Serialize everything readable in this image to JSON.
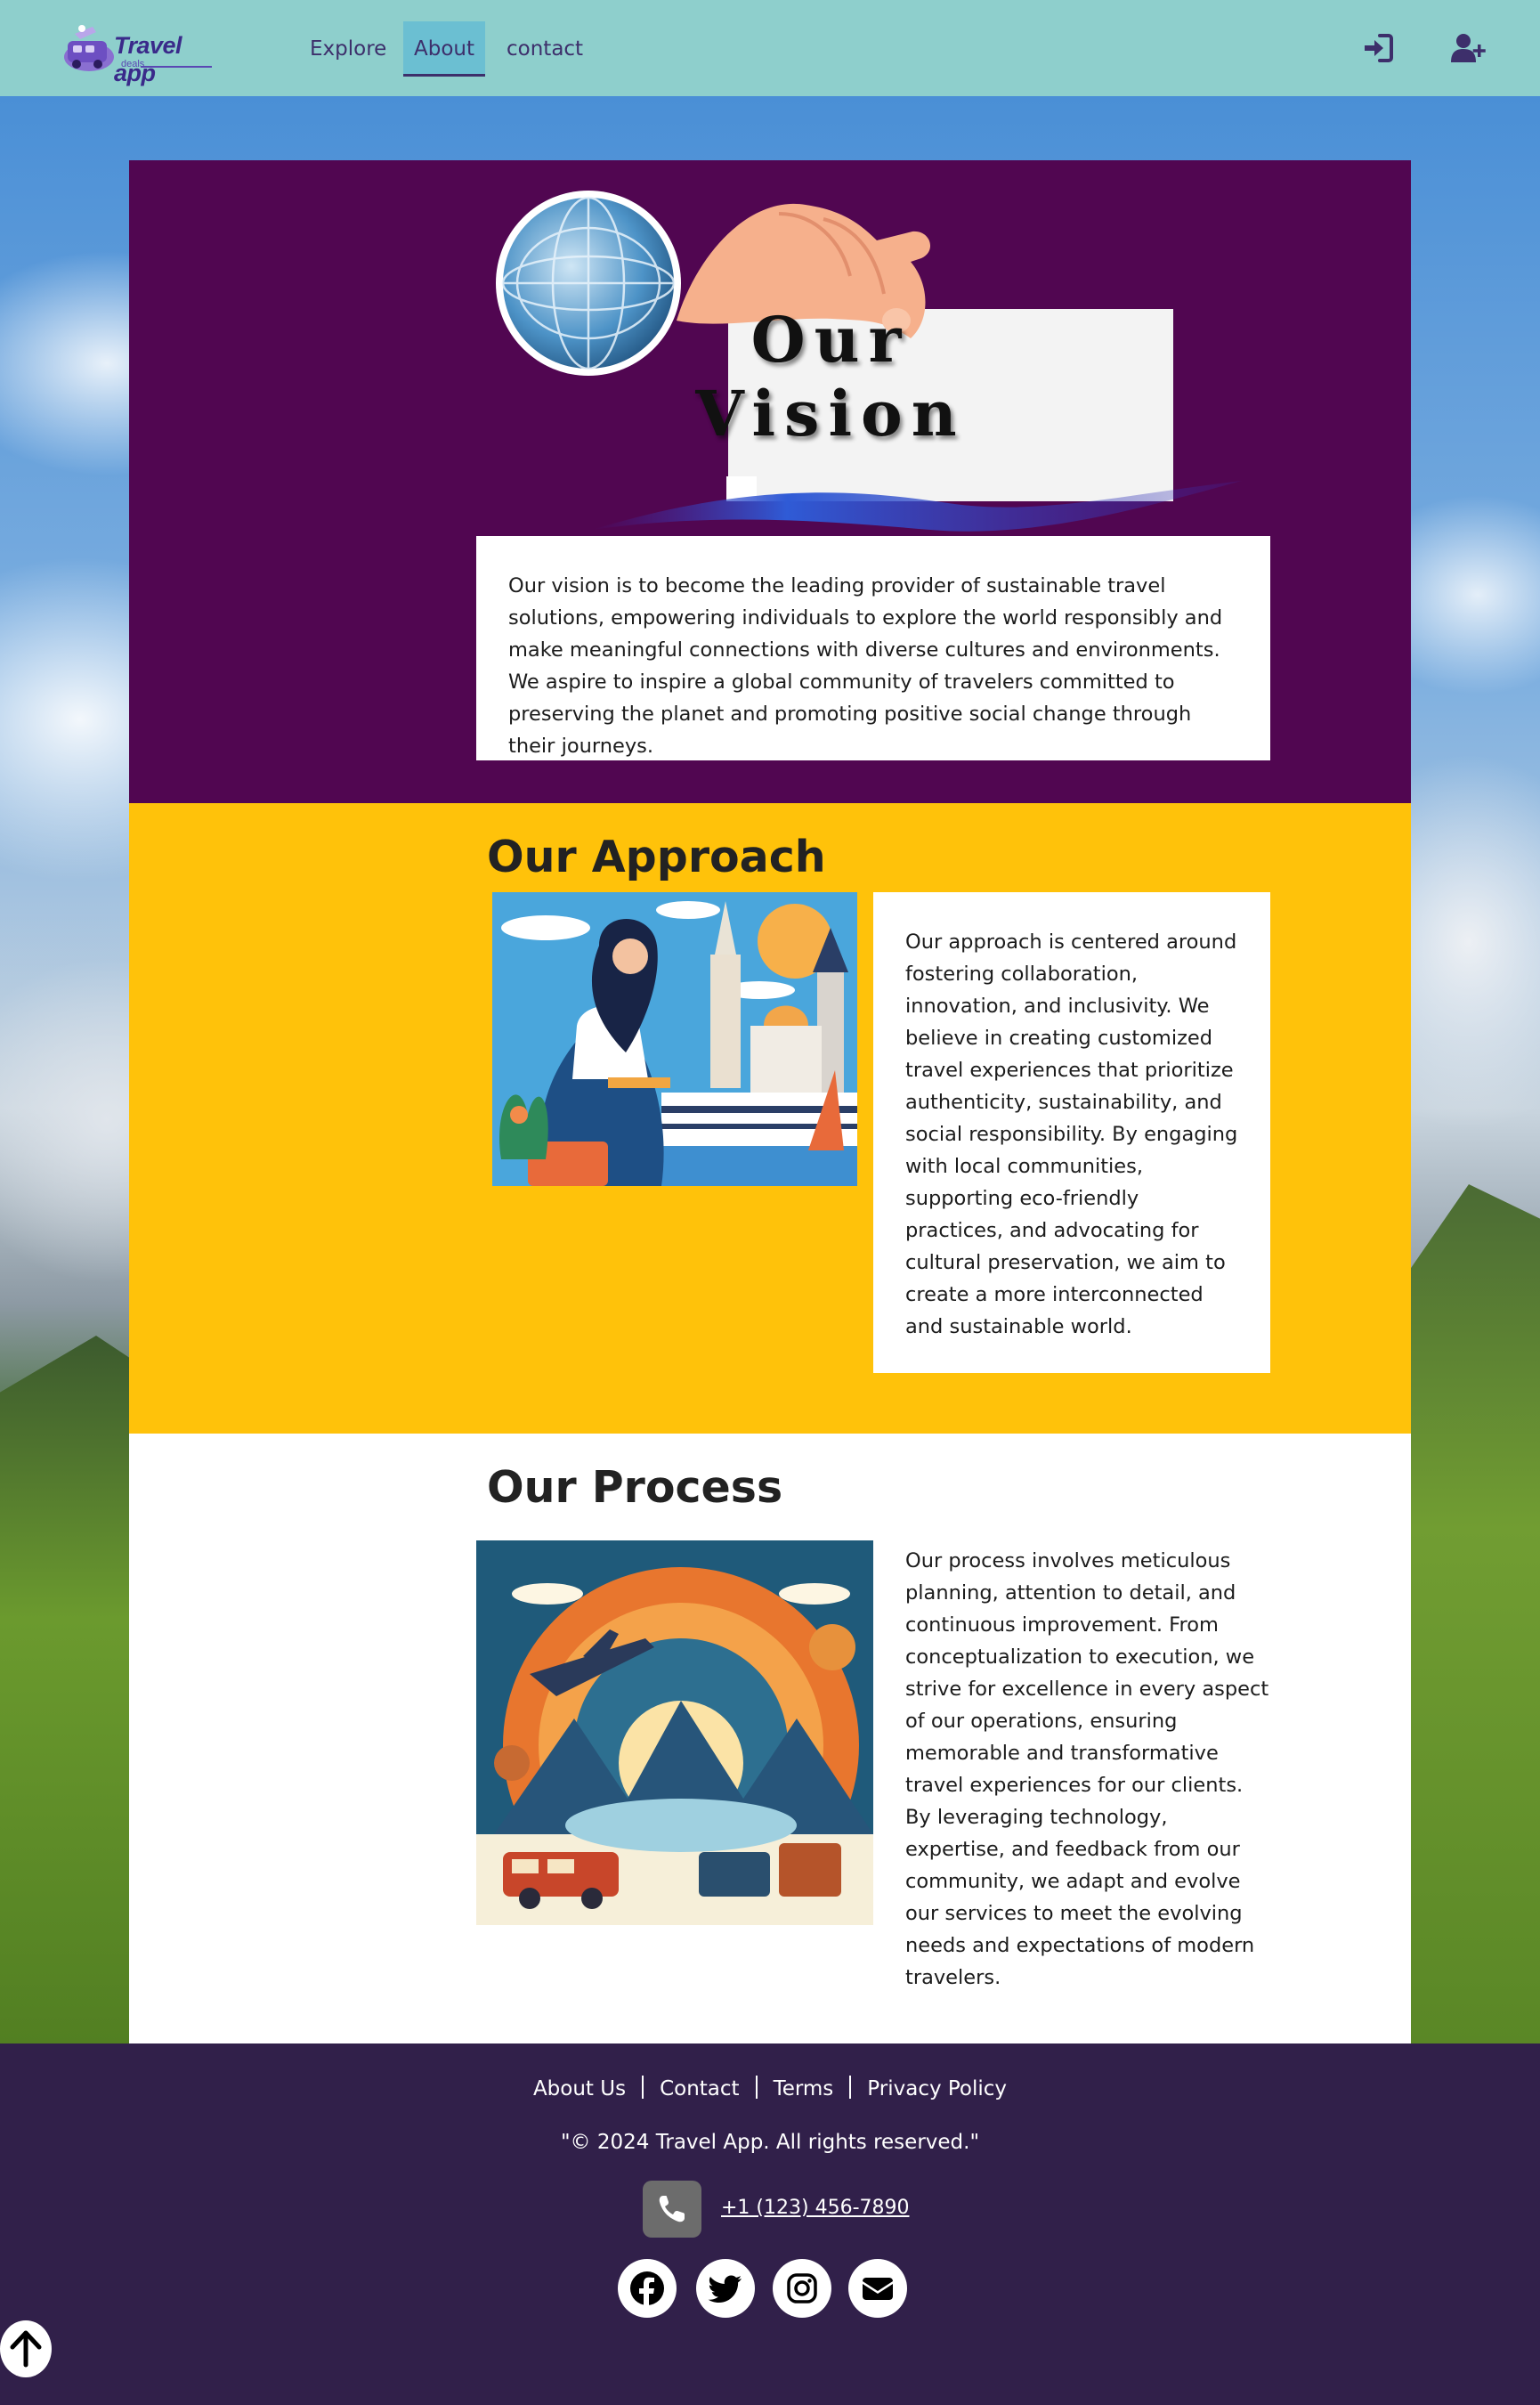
{
  "brand": {
    "name": "Travel app",
    "tagline": "deals"
  },
  "nav": {
    "links": [
      {
        "label": "Explore"
      },
      {
        "label": "About",
        "active": true
      },
      {
        "label": "contact"
      }
    ],
    "icons": [
      "sign-in-icon",
      "user-plus-icon"
    ]
  },
  "vision": {
    "banner_text": "Our Vision",
    "body": "Our vision is to become the leading provider of sustainable travel solutions, empowering individuals to explore the world responsibly and make meaningful connections with diverse cultures and environments. We aspire to inspire a global community of travelers committed to preserving the planet and promoting positive social change through their journeys."
  },
  "approach": {
    "title": "Our Approach",
    "body": "Our approach is centered around fostering collaboration, innovation, and inclusivity. We believe in creating customized travel experiences that prioritize authenticity, sustainability, and social responsibility. By engaging with local communities, supporting eco-friendly practices, and advocating for cultural preservation, we aim to create a more interconnected and sustainable world."
  },
  "process": {
    "title": "Our Process",
    "body": "Our process involves meticulous planning, attention to detail, and continuous improvement. From conceptualization to execution, we strive for excellence in every aspect of our operations, ensuring memorable and transformative travel experiences for our clients. By leveraging technology, expertise, and feedback from our community, we adapt and evolve our services to meet the evolving needs and expectations of modern travelers."
  },
  "footer": {
    "links": [
      {
        "label": "About Us"
      },
      {
        "label": "Contact"
      },
      {
        "label": "Terms"
      },
      {
        "label": "Privacy Policy"
      }
    ],
    "copyright": "\"© 2024 Travel App. All rights reserved.\"",
    "phone": "+1 (123) 456-7890",
    "social_icons": [
      "facebook-icon",
      "twitter-icon",
      "instagram-icon",
      "envelope-icon"
    ]
  },
  "colors": {
    "navbar": "#8ecfcc",
    "vision_bg": "#510651",
    "approach_bg": "#ffc20a",
    "process_bg": "#ffffff",
    "footer_bg": "#31204a",
    "nav_text": "#3d2f6b"
  }
}
